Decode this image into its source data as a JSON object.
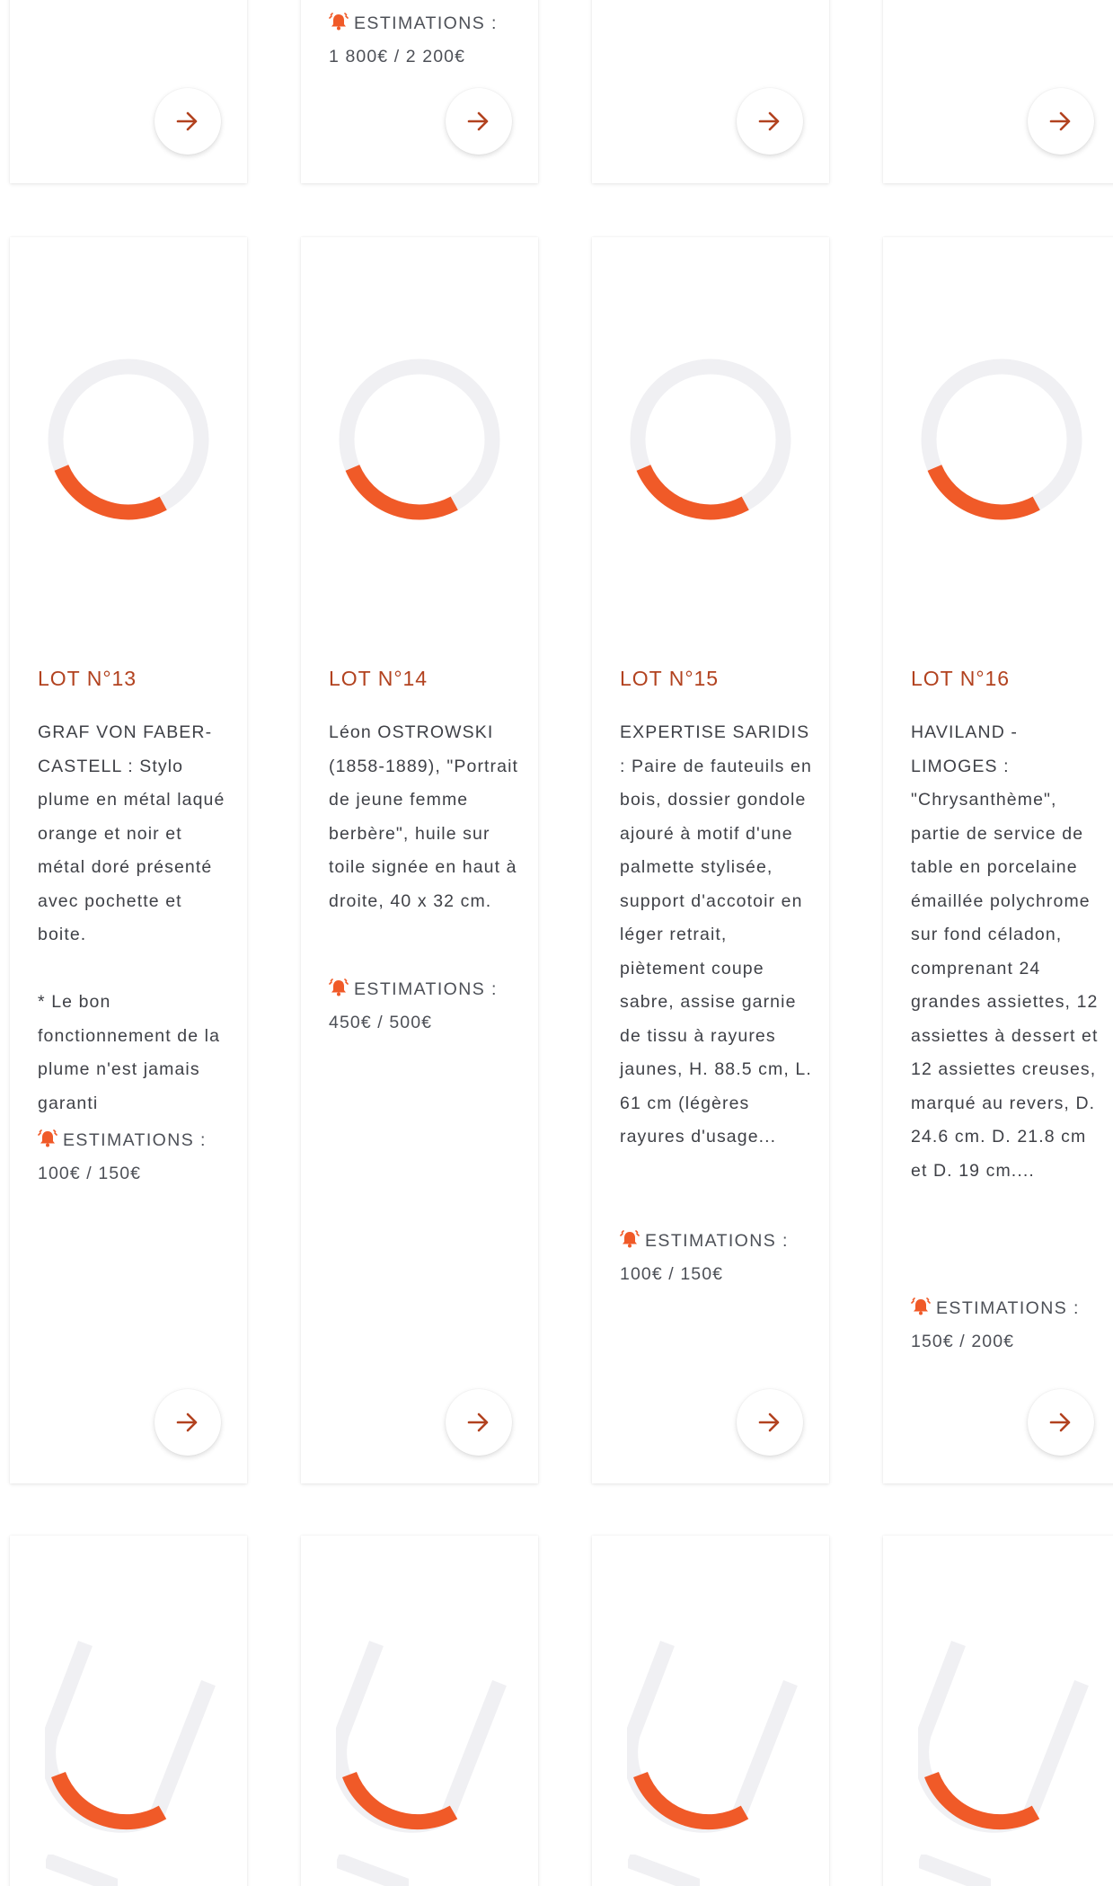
{
  "colors": {
    "accent": "#f05a28",
    "lot_title": "#b2421f",
    "ring_track": "#f0f0f3",
    "text": "#3f4147"
  },
  "icons": {
    "arrow": "arrow-right-icon",
    "bell": "bell-alarm-icon",
    "loader": "loading-ring-icon"
  },
  "top_row": {
    "card_2_estimation_label": "ESTIMATIONS :",
    "card_2_estimation_value": "1 800€ / 2 200€"
  },
  "lots": [
    {
      "title": "LOT N°13",
      "description": "GRAF VON FABER-CASTELL : Stylo plume en métal laqué orange et noir et métal doré présenté avec pochette et boite.\n\n* Le bon fonctionnement de la plume n'est jamais garanti",
      "estimation_label": "ESTIMATIONS :",
      "estimation_value": "100€ / 150€"
    },
    {
      "title": "LOT N°14",
      "description": "Léon OSTROWSKI (1858-1889), \"Portrait de jeune femme berbère\", huile sur toile signée en haut à droite, 40 x 32 cm.",
      "estimation_label": "ESTIMATIONS :",
      "estimation_value": "450€ / 500€"
    },
    {
      "title": "LOT N°15",
      "description": "EXPERTISE SARIDIS : Paire de fauteuils en bois, dossier gondole ajouré à motif d'une palmette stylisée, support d'accotoir en léger retrait, piètement coupe sabre, assise garnie de tissu à rayures jaunes, H. 88.5 cm, L. 61 cm (légères rayures d'usage...",
      "estimation_label": "ESTIMATIONS :",
      "estimation_value": "100€ / 150€"
    },
    {
      "title": "LOT N°16",
      "description": "HAVILAND - LIMOGES : \"Chrysanthème\", partie de service de table en porcelaine émaillée polychrome sur fond céladon, comprenant 24 grandes assiettes, 12 assiettes à dessert et 12 assiettes creuses, marqué au revers, D. 24.6 cm. D. 21.8 cm et D. 19 cm....",
      "estimation_label": "ESTIMATIONS :",
      "estimation_value": "150€ / 200€"
    }
  ]
}
